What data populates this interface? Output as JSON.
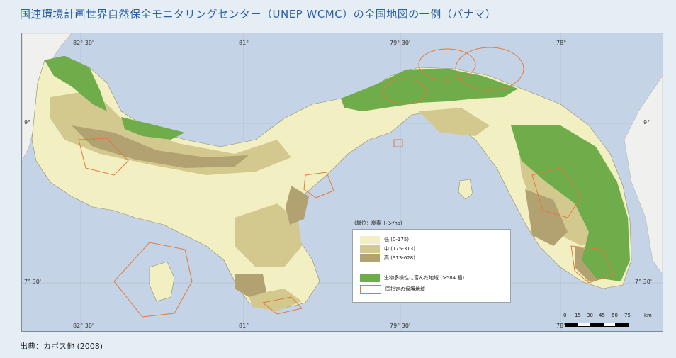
{
  "title": "国連環境計画世界自然保全モニタリングセンター（UNEP WCMC）の全国地図の一例（パナマ）",
  "ticks": {
    "top": [
      "82° 30'",
      "81°",
      "79° 30'",
      "78°"
    ],
    "bottom": [
      "82° 30'",
      "81°",
      "79° 30'",
      "78°"
    ],
    "left": [
      "9°",
      "7° 30'"
    ],
    "right": [
      "9°",
      "7° 30'"
    ]
  },
  "legend": {
    "header": "(単位：炭素 トン/ha)",
    "items": [
      {
        "label": "低 (0-175)",
        "color": "#f2efc2"
      },
      {
        "label": "中 (175-313)",
        "color": "#d3c98f"
      },
      {
        "label": "高 (313-628)",
        "color": "#b3a271"
      },
      {
        "label": "生物多様性に富んだ地域 (>584 種)",
        "color": "#6fad4b"
      },
      {
        "label": "国指定の保護地域",
        "color": "#ffffff",
        "border": "#e07a3a"
      }
    ]
  },
  "scale": {
    "labels": [
      "0",
      "15",
      "30",
      "45",
      "60",
      "75"
    ],
    "unit": "km"
  },
  "source": "出典：カポス他 (2008)",
  "colors": {
    "sea": "#c5d3e6",
    "neighbor_land": "#f0f0ee",
    "low": "#f2efc2",
    "medium": "#d3c98f",
    "high": "#b3a271",
    "biodiversity": "#6fad4b",
    "protected": "#e07a3a",
    "title": "#2a5fa3"
  }
}
